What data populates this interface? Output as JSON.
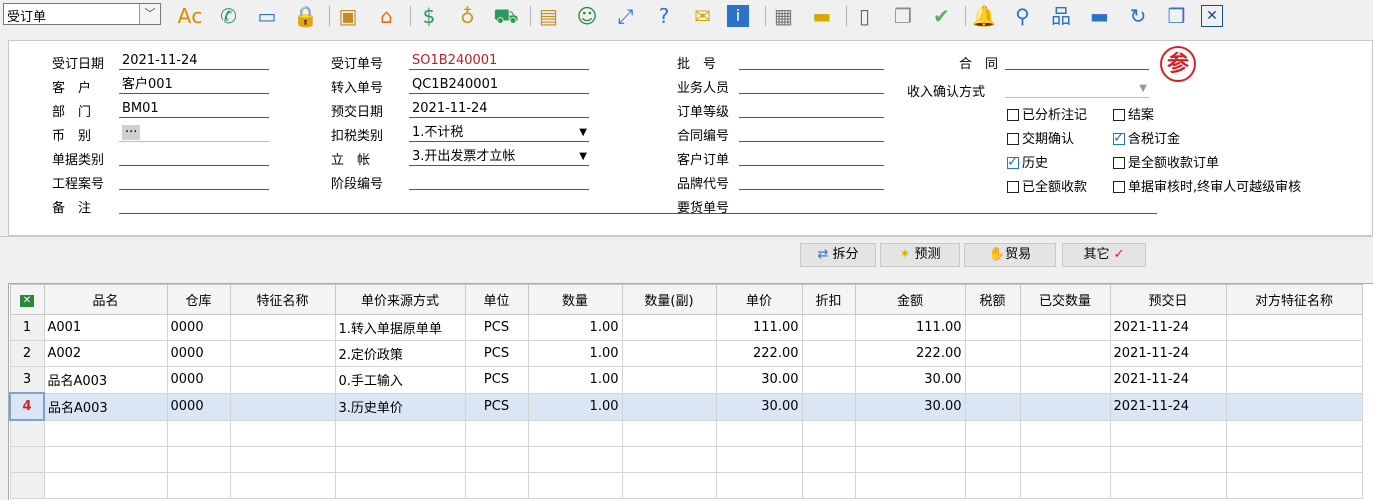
{
  "toolbar": {
    "doc_type": "受订单",
    "icons": [
      "spell-check-icon",
      "phone-icon",
      "monitor-icon",
      "lock-icon",
      "briefcase-icon",
      "home-icon",
      "dollar-icon",
      "money-bag-icon",
      "cart-icon",
      "clipboard-icon",
      "users-icon",
      "link-icon",
      "help-doc-icon",
      "mail-icon",
      "info-icon",
      "calculator-icon",
      "folder-icon",
      "document-icon",
      "copy-document-icon",
      "check-circle-icon",
      "bell-icon",
      "search-icon",
      "org-chart-icon",
      "display-icon",
      "refresh-icon",
      "window-icon",
      "close-icon"
    ]
  },
  "form": {
    "order_date": {
      "label": "受订日期",
      "value": "2021-11-24"
    },
    "customer": {
      "label": "客　户",
      "value": "客户001"
    },
    "department": {
      "label": "部　门",
      "value": "BM01"
    },
    "currency": {
      "label": "币　别",
      "value": "···"
    },
    "doc_category": {
      "label": "单据类别",
      "value": ""
    },
    "project_no": {
      "label": "工程案号",
      "value": ""
    },
    "remark": {
      "label": "备　注",
      "value": ""
    },
    "order_no": {
      "label": "受订单号",
      "value": "SO1B240001"
    },
    "transfer_no": {
      "label": "转入单号",
      "value": "QC1B240001"
    },
    "expected_date": {
      "label": "预交日期",
      "value": "2021-11-24"
    },
    "tax_type": {
      "label": "扣税类别",
      "value": "1.不计税"
    },
    "account": {
      "label": "立　帐",
      "value": "3.开出发票才立帐"
    },
    "stage_no": {
      "label": "阶段编号",
      "value": ""
    },
    "batch_no": {
      "label": "批　号",
      "value": ""
    },
    "salesperson": {
      "label": "业务人员",
      "value": ""
    },
    "order_level": {
      "label": "订单等级",
      "value": ""
    },
    "contract_no": {
      "label": "合同编号",
      "value": ""
    },
    "customer_order": {
      "label": "客户订单",
      "value": ""
    },
    "brand_code": {
      "label": "品牌代号",
      "value": ""
    },
    "request_no": {
      "label": "要货单号",
      "value": ""
    },
    "contract": {
      "label": "合　同",
      "value": ""
    },
    "income_confirm": {
      "label": "收入确认方式",
      "value": ""
    },
    "stamp": "参"
  },
  "checkboxes": [
    {
      "label": "已分析注记",
      "checked": false
    },
    {
      "label": "结案",
      "checked": false
    },
    {
      "label": "交期确认",
      "checked": false
    },
    {
      "label": "含税订金",
      "checked": true
    },
    {
      "label": "历史",
      "checked": true
    },
    {
      "label": "是全额收款订单",
      "checked": false
    },
    {
      "label": "已全额收款",
      "checked": false
    },
    {
      "label": "单据审核时,终审人可越级审核",
      "checked": false
    }
  ],
  "buttons": {
    "split": "拆分",
    "forecast": "预测",
    "trade": "贸易",
    "other": "其它",
    "other_check": "✓"
  },
  "grid": {
    "headers": [
      "品名",
      "仓库",
      "特征名称",
      "单价来源方式",
      "单位",
      "数量",
      "数量(副)",
      "单价",
      "折扣",
      "金额",
      "税额",
      "已交数量",
      "预交日",
      "对方特征名称"
    ],
    "rows": [
      {
        "no": "1",
        "name": "A001",
        "warehouse": "0000",
        "feature": "",
        "price_source": "1.转入单据原单单",
        "unit": "PCS",
        "qty": "1.00",
        "qty2": "",
        "price": "111.00",
        "discount": "",
        "amount": "111.00",
        "tax": "",
        "delivered": "",
        "date": "2021-11-24",
        "other_feature": ""
      },
      {
        "no": "2",
        "name": "A002",
        "warehouse": "0000",
        "feature": "",
        "price_source": "2.定价政策",
        "unit": "PCS",
        "qty": "1.00",
        "qty2": "",
        "price": "222.00",
        "discount": "",
        "amount": "222.00",
        "tax": "",
        "delivered": "",
        "date": "2021-11-24",
        "other_feature": ""
      },
      {
        "no": "3",
        "name": "品名A003",
        "warehouse": "0000",
        "feature": "",
        "price_source": "0.手工输入",
        "unit": "PCS",
        "qty": "1.00",
        "qty2": "",
        "price": "30.00",
        "discount": "",
        "amount": "30.00",
        "tax": "",
        "delivered": "",
        "date": "2021-11-24",
        "other_feature": ""
      },
      {
        "no": "4",
        "name": "品名A003",
        "warehouse": "0000",
        "feature": "",
        "price_source": "3.历史单价",
        "unit": "PCS",
        "qty": "1.00",
        "qty2": "",
        "price": "30.00",
        "discount": "",
        "amount": "30.00",
        "tax": "",
        "delivered": "",
        "date": "2021-11-24",
        "other_feature": ""
      }
    ],
    "selected_row": 3,
    "empty_rows": 3
  },
  "colors": {
    "accent": "#2b72c9",
    "stamp": "#d8202a",
    "selected_row": "#dbe6f4",
    "order_no_text": "#b8202a"
  }
}
